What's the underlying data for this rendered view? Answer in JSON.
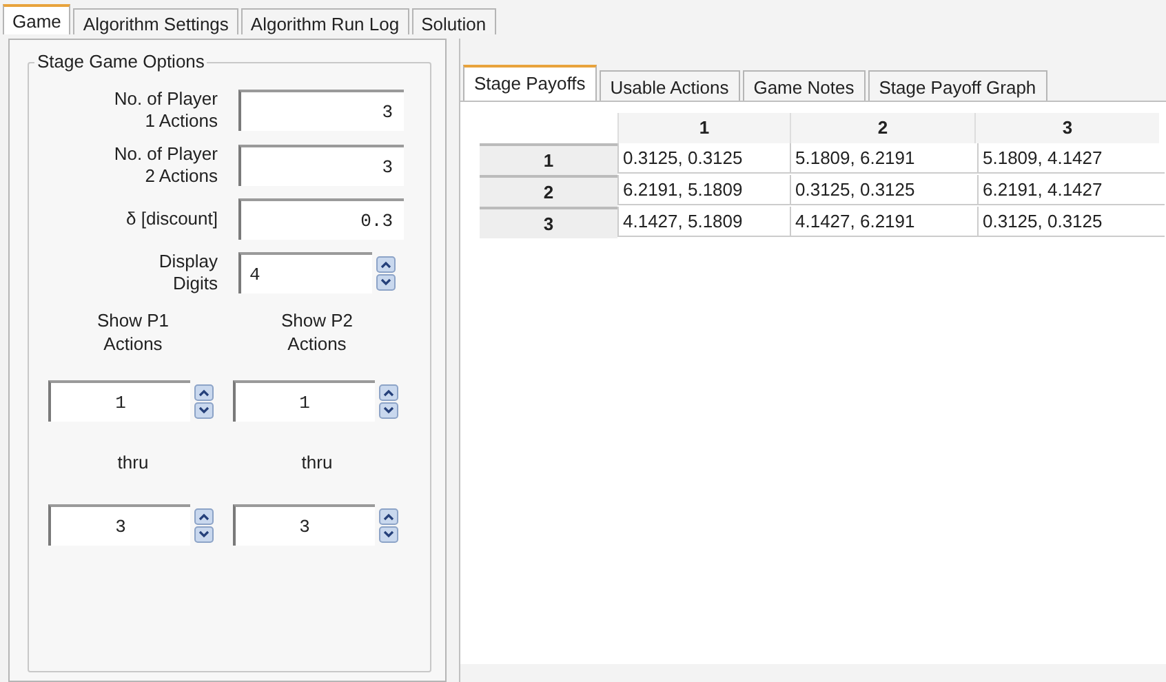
{
  "tabs": [
    {
      "label": "Game",
      "selected": true
    },
    {
      "label": "Algorithm Settings",
      "selected": false
    },
    {
      "label": "Algorithm Run Log",
      "selected": false
    },
    {
      "label": "Solution",
      "selected": false
    }
  ],
  "stage_game_options": {
    "title": "Stage Game Options",
    "fields": [
      {
        "label": "No. of Player\n1 Actions",
        "value": "3",
        "kind": "text"
      },
      {
        "label": "No. of Player\n2 Actions",
        "value": "3",
        "kind": "text"
      },
      {
        "label": "δ [discount]",
        "value": "0.3",
        "kind": "text"
      },
      {
        "label": "Display\nDigits",
        "value": "4",
        "kind": "spinner"
      }
    ],
    "action_ranges": [
      {
        "label": "Show P1\nActions",
        "from": "1",
        "thru_label": "thru",
        "to": "3"
      },
      {
        "label": "Show P2\nActions",
        "from": "1",
        "thru_label": "thru",
        "to": "3"
      }
    ]
  },
  "sub_tabs": [
    {
      "label": "Stage Payoffs",
      "selected": true
    },
    {
      "label": "Usable Actions",
      "selected": false
    },
    {
      "label": "Game Notes",
      "selected": false
    },
    {
      "label": "Stage Payoff Graph",
      "selected": false
    }
  ],
  "payoff_table": {
    "columns": [
      "1",
      "2",
      "3"
    ],
    "rows": [
      {
        "header": "1",
        "cells": [
          "0.3125, 0.3125",
          "5.1809, 6.2191",
          "5.1809, 4.1427"
        ]
      },
      {
        "header": "2",
        "cells": [
          "6.2191, 5.1809",
          "0.3125, 0.3125",
          "6.2191, 4.1427"
        ]
      },
      {
        "header": "3",
        "cells": [
          "4.1427, 5.1809",
          "4.1427, 6.2191",
          "0.3125, 0.3125"
        ]
      }
    ]
  }
}
